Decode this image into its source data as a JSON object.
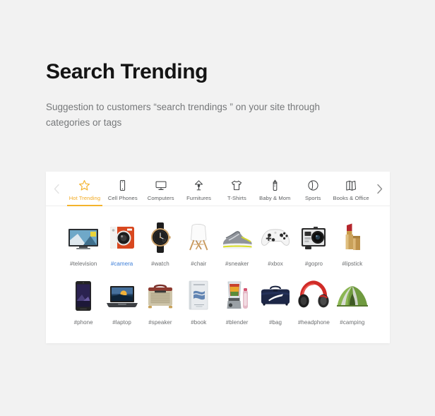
{
  "header": {
    "title": "Search Trending",
    "subtitle": "Suggestion to customers “search trendings ” on your site through categories or tags"
  },
  "colors": {
    "page_background": "#f2f2f2",
    "card_background": "#ffffff",
    "accent_active_tab": "#f2aa23",
    "accent_underline": "#f4b32c",
    "label_default": "#6b6d6f",
    "label_highlight": "#3b7dd8",
    "arrow_prev": "#e2e2e2",
    "arrow_next": "#8d8d8d"
  },
  "carousel": {
    "prev_arrow": "chevron-left-icon",
    "next_arrow": "chevron-right-icon"
  },
  "tabs": [
    {
      "label": "Hot Trending",
      "icon": "star-icon",
      "active": true
    },
    {
      "label": "Cell Phones",
      "icon": "smartphone-icon",
      "active": false
    },
    {
      "label": "Computers",
      "icon": "monitor-icon",
      "active": false
    },
    {
      "label": "Furnitures",
      "icon": "lamp-icon",
      "active": false
    },
    {
      "label": "T-Shirts",
      "icon": "tshirt-icon",
      "active": false
    },
    {
      "label": "Baby & Mom",
      "icon": "baby-bottle-icon",
      "active": false
    },
    {
      "label": "Sports",
      "icon": "ball-icon",
      "active": false
    },
    {
      "label": "Books & Office",
      "icon": "books-icon",
      "active": false
    }
  ],
  "grid": {
    "rows": [
      [
        {
          "label": "#television",
          "icon": "television-thumb",
          "highlight": false
        },
        {
          "label": "#camera",
          "icon": "camera-thumb",
          "highlight": true
        },
        {
          "label": "#watch",
          "icon": "watch-thumb",
          "highlight": false
        },
        {
          "label": "#chair",
          "icon": "chair-thumb",
          "highlight": false
        },
        {
          "label": "#sneaker",
          "icon": "sneaker-thumb",
          "highlight": false
        },
        {
          "label": "#xbox",
          "icon": "gamepad-thumb",
          "highlight": false
        },
        {
          "label": "#gopro",
          "icon": "actioncam-thumb",
          "highlight": false
        },
        {
          "label": "#lipstick",
          "icon": "lipstick-thumb",
          "highlight": false
        }
      ],
      [
        {
          "label": "#phone",
          "icon": "phone-thumb",
          "highlight": false
        },
        {
          "label": "#laptop",
          "icon": "laptop-thumb",
          "highlight": false
        },
        {
          "label": "#speaker",
          "icon": "speaker-thumb",
          "highlight": false
        },
        {
          "label": "#book",
          "icon": "book-thumb",
          "highlight": false
        },
        {
          "label": "#blender",
          "icon": "blender-thumb",
          "highlight": false
        },
        {
          "label": "#bag",
          "icon": "bag-thumb",
          "highlight": false
        },
        {
          "label": "#headphone",
          "icon": "headphone-thumb",
          "highlight": false
        },
        {
          "label": "#camping",
          "icon": "tent-thumb",
          "highlight": false
        }
      ]
    ]
  }
}
